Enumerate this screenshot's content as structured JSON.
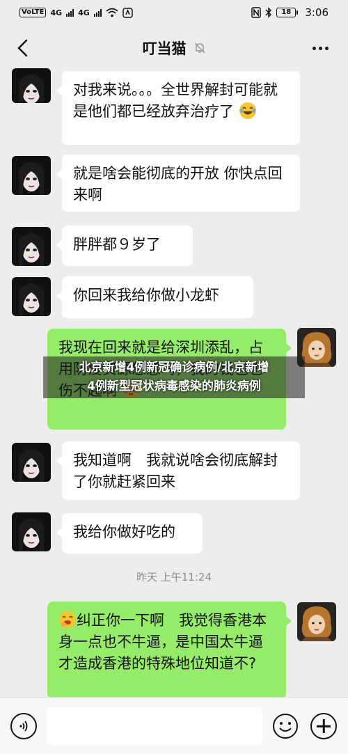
{
  "status_bar": {
    "sim1": "VoLTE",
    "net1": "4G",
    "net2": "4G",
    "battery": "18",
    "time": "3:06"
  },
  "header": {
    "title": "叮当猫",
    "muted_icon": "bell-off-icon",
    "more_icon": "more-dots-icon",
    "back_icon": "chevron-left-icon"
  },
  "messages": [
    {
      "side": "in",
      "text": "对我来说。。。全世界解封可能就是他们都已经放弃治疗了",
      "emoji": "laughing-tears"
    },
    {
      "side": "in",
      "text": "就是啥会能彻底的开放 你快点回来啊"
    },
    {
      "side": "in",
      "text": "胖胖都９岁了"
    },
    {
      "side": "in",
      "text": "你回来我给你做小龙虾"
    },
    {
      "side": "out",
      "text": "我现在回来就是给深圳添乱，占用防疫资源您感吗，我的钱包也伤不起啊",
      "emoji": "flushed"
    },
    {
      "side": "in",
      "text": "我知道啊　我就说啥会彻底解封了你就赶紧回来"
    },
    {
      "side": "in",
      "text": "我给你做好吃的"
    },
    {
      "side": "out",
      "text": "纠正你一下啊　我觉得香港本身一点也不牛逼，是中国太牛逼才造成香港的特殊地位知道不?",
      "emoji_lead": "face-with-hand"
    }
  ],
  "timestamp": "昨天 上午11:24",
  "caption": {
    "line1": "北京新增4例新冠确诊病例/北京新增",
    "line2": "4例新型冠状病毒感染的肺炎病例"
  },
  "input_bar": {
    "voice_icon": "voice-icon",
    "emoji_icon": "emoji-icon",
    "plus_icon": "plus-icon"
  },
  "colors": {
    "background": "#ededed",
    "bubble_in": "#ffffff",
    "bubble_out": "#95ec69"
  }
}
